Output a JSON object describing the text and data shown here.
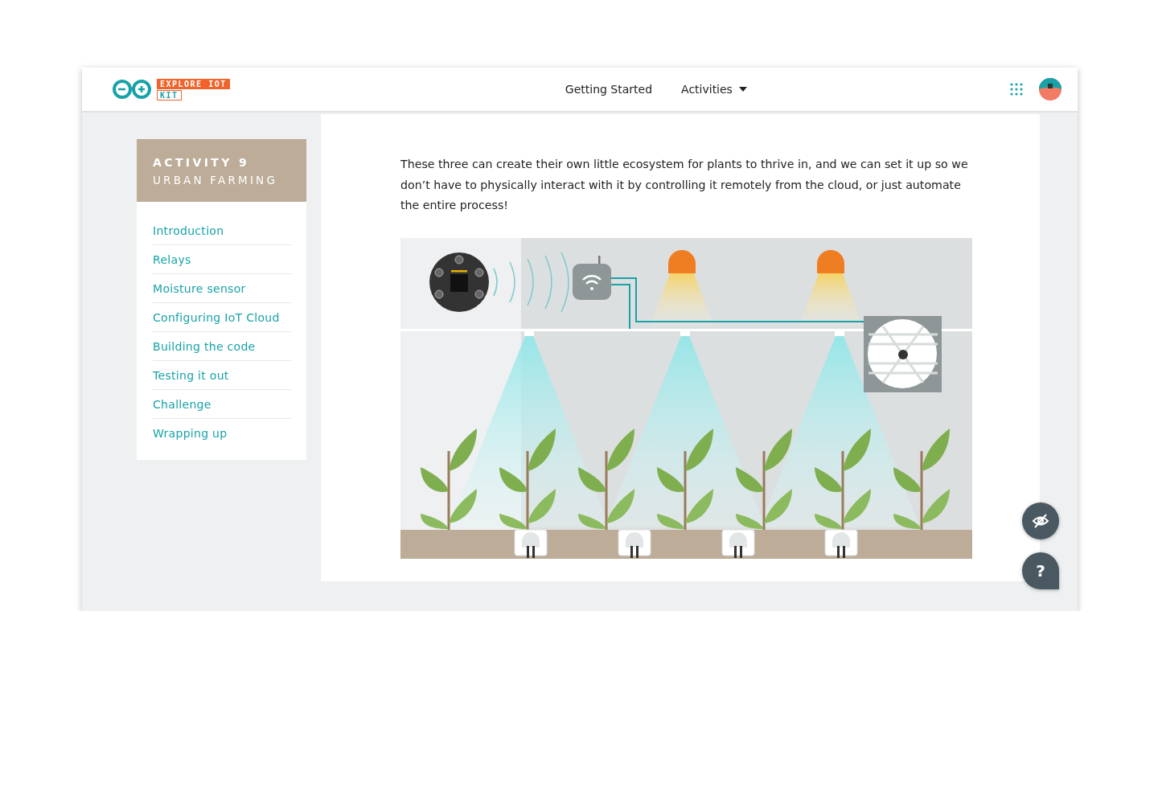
{
  "header": {
    "logo_badge": "EXPLORE IOT",
    "logo_sub": "KIT",
    "nav": [
      {
        "label": "Getting Started",
        "kind": "link"
      },
      {
        "label": "Activities",
        "kind": "dropdown"
      }
    ]
  },
  "sidebar": {
    "title": "ACTIVITY 9",
    "subtitle": "URBAN FARMING",
    "items": [
      "Introduction",
      "Relays",
      "Moisture sensor",
      "Configuring IoT Cloud",
      "Building the code",
      "Testing it out",
      "Challenge",
      "Wrapping up"
    ]
  },
  "content": {
    "paragraph": "These three can create their own little ecosystem for plants to thrive in, and we can set it up so we don’t have to physically interact with it by controlling it remotely from the cloud, or just automate the entire process!"
  },
  "help_button": "?"
}
